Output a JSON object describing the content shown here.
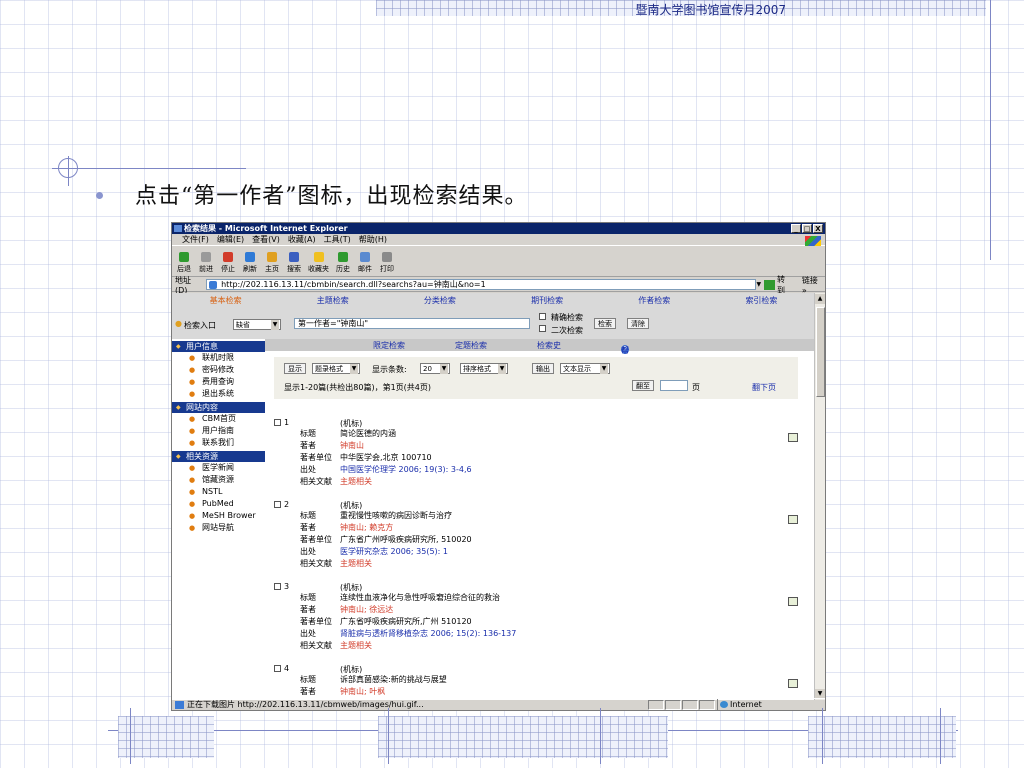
{
  "slide": {
    "header": "暨南大学图书馆宣传月2007",
    "instruction": "点击“第一作者”图标，出现检索结果。"
  },
  "window": {
    "title": "检索结果 - Microsoft Internet Explorer",
    "controls": [
      "_",
      "□",
      "X"
    ],
    "menu": [
      "文件(F)",
      "编辑(E)",
      "查看(V)",
      "收藏(A)",
      "工具(T)",
      "帮助(H)"
    ],
    "toolbar": [
      {
        "label": "后退",
        "icon": "back-icon",
        "color": "#2f9a2f"
      },
      {
        "label": "前进",
        "icon": "forward-icon",
        "color": "#9a9a9a"
      },
      {
        "label": "停止",
        "icon": "stop-icon",
        "color": "#d23c2a"
      },
      {
        "label": "刷新",
        "icon": "refresh-icon",
        "color": "#2f7ad6"
      },
      {
        "label": "主页",
        "icon": "home-icon",
        "color": "#e0a020"
      },
      {
        "label": "搜索",
        "icon": "search-icon",
        "color": "#3b5fc0"
      },
      {
        "label": "收藏夹",
        "icon": "star-icon",
        "color": "#f0c020"
      },
      {
        "label": "历史",
        "icon": "history-icon",
        "color": "#2f9a2f"
      },
      {
        "label": "邮件",
        "icon": "mail-icon",
        "color": "#5a8ad0"
      },
      {
        "label": "打印",
        "icon": "print-icon",
        "color": "#8a8a8a"
      }
    ],
    "address_label": "地址(D)",
    "address": "http://202.116.13.11/cbmbin/search.dll?searchs?au=钟南山&no=1",
    "go_label": "转到",
    "links_label": "链接 »",
    "status_text": "正在下载图片 http://202.116.13.11/cbmweb/images/hui.gif...",
    "zone": "Internet"
  },
  "page": {
    "tabs": [
      "基本检索",
      "主题检索",
      "分类检索",
      "期刊检索",
      "作者检索",
      "索引检索"
    ],
    "active_tab": "基本检索",
    "entry_label": "检索入口",
    "entry_value": "缺省",
    "query": "第一作者=\"钟南山\"",
    "precise_label": "精确检索",
    "secondary_label": "二次检索",
    "search_btn": "检索",
    "clear_btn": "清除",
    "nav_links": [
      "限定检索",
      "定题检索",
      "检索史",
      "帮助"
    ],
    "sidebar": [
      {
        "head": "用户信息",
        "items": [
          "联机时限",
          "密码修改",
          "费用查询",
          "退出系统"
        ]
      },
      {
        "head": "网站内容",
        "items": [
          "CBM首页",
          "用户指南",
          "联系我们"
        ]
      },
      {
        "head": "相关资源",
        "items": [
          "医学新闻",
          "馆藏资源",
          "NSTL",
          "PubMed",
          "MeSH Brower",
          "网站导航"
        ]
      }
    ],
    "controls": {
      "show_btn": "显示",
      "format": "题录格式",
      "count_label": "显示条数:",
      "count": "20",
      "sort": "排序格式",
      "output_btn": "输出",
      "output_format": "文本显示",
      "summary": "显示1-20篇(共检出80篇)，第1页(共4页)",
      "goto_btn": "翻至",
      "page_suffix": "页",
      "next_page": "翻下页"
    },
    "field_labels": {
      "title": "标题",
      "author": "著者",
      "affiliation": "著者单位",
      "source": "出处",
      "related": "相关文献"
    },
    "records": [
      {
        "num": "1",
        "type": "(机标)",
        "title": "简论医德的内涵",
        "author": "钟南山",
        "affiliation": "中华医学会,北京 100710",
        "source": "中国医学伦理学 2006; 19(3): 3-4,6",
        "related": "主题相关"
      },
      {
        "num": "2",
        "type": "(机标)",
        "title": "重视慢性咳嗽的病因诊断与治疗",
        "author": "钟南山; 赖克方",
        "affiliation": "广东省广州呼吸疾病研究所, 510020",
        "source": "医学研究杂志 2006; 35(5): 1",
        "related": "主题相关"
      },
      {
        "num": "3",
        "type": "(机标)",
        "title": "连续性血液净化与急性呼吸窘迫综合征的救治",
        "author": "钟南山; 徐远达",
        "affiliation": "广东省呼吸疾病研究所,广州 510120",
        "source": "肾脏病与透析肾移植杂志 2006; 15(2): 136-137",
        "related": "主题相关"
      },
      {
        "num": "4",
        "type": "(机标)",
        "title": "诉部真菌感染:新的挑战与展望",
        "author": "钟南山; 叶枫",
        "affiliation": "",
        "source": "",
        "related": ""
      }
    ]
  }
}
